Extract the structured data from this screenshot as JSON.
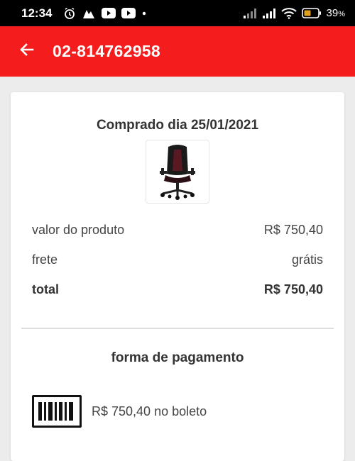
{
  "status_bar": {
    "time": "12:34",
    "battery": "39",
    "battery_unit": "%",
    "icons": [
      "alarm-icon",
      "shopping-icon",
      "youtube-icon",
      "youtube-icon",
      "dot-icon",
      "signal-icon",
      "signal-icon",
      "wifi-icon",
      "battery-icon"
    ]
  },
  "app_bar": {
    "title": "02-814762958",
    "back_icon": "arrow-left-icon",
    "color": "#f41c1c"
  },
  "order": {
    "purchase_date_label": "Comprado dia 25/01/2021",
    "product_image": "gaming-chair-image",
    "rows": [
      {
        "label": "valor do produto",
        "value": "R$ 750,40"
      },
      {
        "label": "frete",
        "value": "grátis"
      },
      {
        "label": "total",
        "value": "R$ 750,40"
      }
    ]
  },
  "payment": {
    "title": "forma de pagamento",
    "method_icon": "barcode-icon",
    "method_text": "R$ 750,40 no boleto"
  }
}
